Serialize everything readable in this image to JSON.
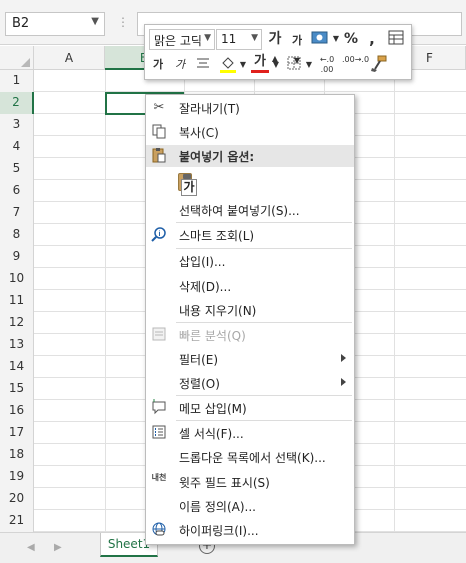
{
  "name_box": {
    "value": "B2"
  },
  "formula_bar": {
    "separator": "⋮"
  },
  "columns": [
    "A",
    "B",
    "C",
    "D",
    "E",
    "F"
  ],
  "rows": [
    "1",
    "2",
    "3",
    "4",
    "5",
    "6",
    "7",
    "8",
    "9",
    "10",
    "11",
    "12",
    "13",
    "14",
    "15",
    "16",
    "17",
    "18",
    "19",
    "20",
    "21"
  ],
  "active_cell": "B2",
  "mini_toolbar": {
    "font_name": "맑은 고딕",
    "font_size": "11",
    "grow_font": "가",
    "shrink_font": "가",
    "percent": "%",
    "comma": ",",
    "bold": "가",
    "italic": "가",
    "font_color_glyph": "가",
    "decrease_decimal": ".00→.0",
    "increase_decimal": "←.0 .00"
  },
  "context_menu": {
    "cut": "잘라내기(T)",
    "copy": "복사(C)",
    "paste_options_header": "붙여넣기 옵션:",
    "paste_glyph": "가",
    "paste_special": "선택하여 붙여넣기(S)...",
    "smart_lookup": "스마트 조회(L)",
    "insert": "삽입(I)...",
    "delete": "삭제(D)...",
    "clear_contents": "내용 지우기(N)",
    "quick_analysis": "빠른 분석(Q)",
    "filter": "필터(E)",
    "sort": "정렬(O)",
    "insert_comment": "메모 삽입(M)",
    "format_cells": "셀 서식(F)...",
    "pick_from_dropdown": "드롭다운 목록에서 선택(K)...",
    "phonetic_field": "윗주 필드 표시(S)",
    "define_name": "이름 정의(A)...",
    "hyperlink": "하이퍼링크(I)...",
    "phonetic_icon": "내천"
  },
  "sheet_tabs": [
    {
      "label": "Sheet1",
      "active": true
    }
  ],
  "colors": {
    "accent": "#217346",
    "header_bg": "#f3f3f3",
    "highlight": "#e6e6e6"
  }
}
